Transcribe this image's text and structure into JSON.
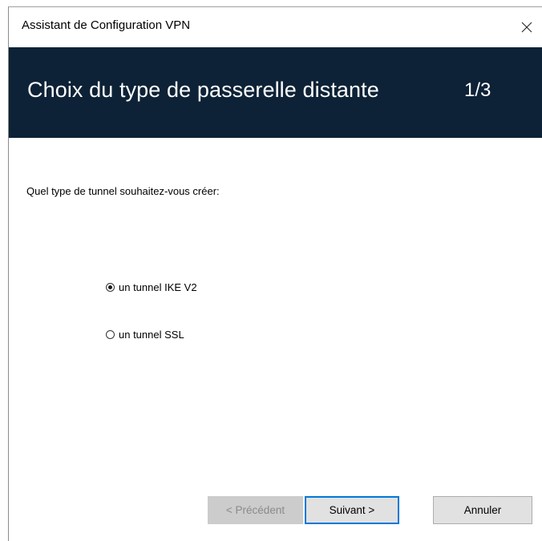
{
  "window": {
    "title": "Assistant de Configuration VPN"
  },
  "header": {
    "title": "Choix du type de passerelle distante",
    "step": "1/3",
    "background_color": "#0d2236"
  },
  "content": {
    "question": "Quel type de tunnel souhaitez-vous créer:",
    "options": [
      {
        "label": "un tunnel IKE V2",
        "selected": true
      },
      {
        "label": "un tunnel SSL",
        "selected": false
      }
    ]
  },
  "footer": {
    "prev_label": "< Précédent",
    "prev_enabled": false,
    "next_label": "Suivant >",
    "cancel_label": "Annuler",
    "accent_color": "#0078d7"
  },
  "icons": {
    "close": "close-icon"
  }
}
